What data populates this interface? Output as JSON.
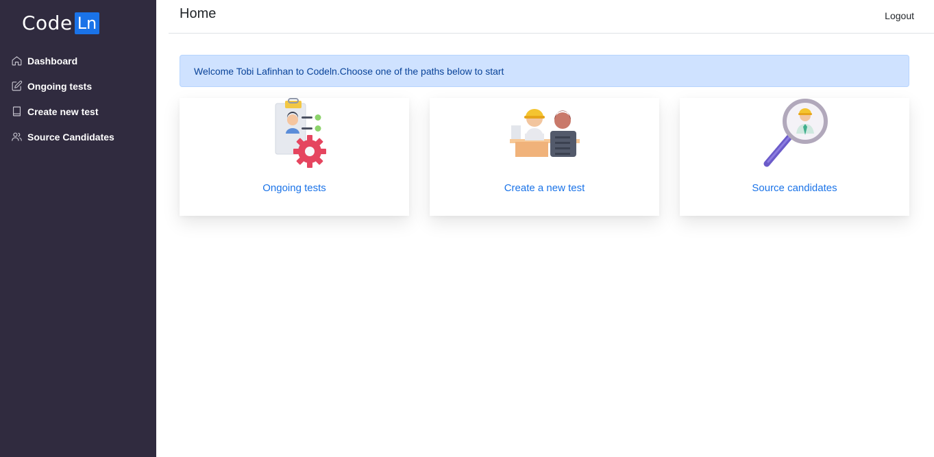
{
  "app": {
    "logo_text": "Code",
    "logo_box": "Ln"
  },
  "sidebar": {
    "items": [
      {
        "label": "Dashboard",
        "icon": "home-icon"
      },
      {
        "label": "Ongoing tests",
        "icon": "edit-icon"
      },
      {
        "label": "Create new test",
        "icon": "book-icon"
      },
      {
        "label": "Source Candidates",
        "icon": "users-icon"
      }
    ]
  },
  "header": {
    "title": "Home",
    "logout_label": "Logout"
  },
  "alert": {
    "text": "Welcome Tobi Lafinhan to Codeln.Choose one of the paths below to start"
  },
  "cards": [
    {
      "label": "Ongoing tests",
      "icon": "clipboard-gear-icon"
    },
    {
      "label": "Create a new test",
      "icon": "interview-desk-icon"
    },
    {
      "label": "Source candidates",
      "icon": "magnifier-candidate-icon"
    }
  ],
  "colors": {
    "sidebar_bg": "#302b3f",
    "accent": "#1a73e8",
    "alert_bg": "#cfe2ff",
    "alert_text": "#084298"
  }
}
